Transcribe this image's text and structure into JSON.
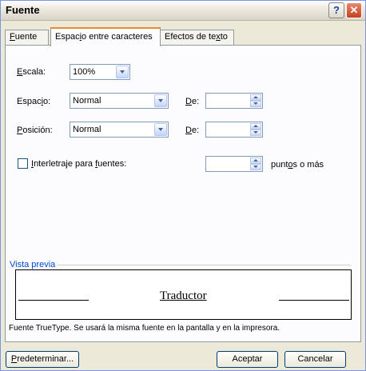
{
  "window": {
    "title": "Fuente",
    "help": "?",
    "close": "✕"
  },
  "tabs": [
    {
      "pre": "",
      "key": "F",
      "post": "uente"
    },
    {
      "pre": "Espac",
      "key": "i",
      "post": "o entre caracteres"
    },
    {
      "pre": "Efectos de te",
      "key": "x",
      "post": "to"
    }
  ],
  "fields": {
    "escala": {
      "pre": "",
      "key": "E",
      "post": "scala:",
      "value": "100%"
    },
    "espacio": {
      "pre": "Espac",
      "key": "i",
      "post": "o:",
      "value": "Normal"
    },
    "posicion": {
      "pre": "",
      "key": "P",
      "post": "osición:",
      "value": "Normal"
    },
    "de1": {
      "pre": "",
      "key": "D",
      "post": "e:"
    },
    "de2": {
      "pre": "",
      "key": "D",
      "post": "e:"
    }
  },
  "kerning": {
    "pre": "",
    "key": "I",
    "post": "nterletraje para ",
    "key2": "f",
    "post2": "uentes:",
    "checked": false,
    "suffix_pre": "punt",
    "suffix_key": "o",
    "suffix_post": "s o más"
  },
  "preview": {
    "label": "Vista previa",
    "sample": "Traductor",
    "note": "Fuente TrueType. Se usará la misma fuente en la pantalla y en la impresora."
  },
  "buttons": {
    "default": {
      "pre": "",
      "key": "P",
      "post": "redeterminar..."
    },
    "ok": "Aceptar",
    "cancel": "Cancelar"
  }
}
